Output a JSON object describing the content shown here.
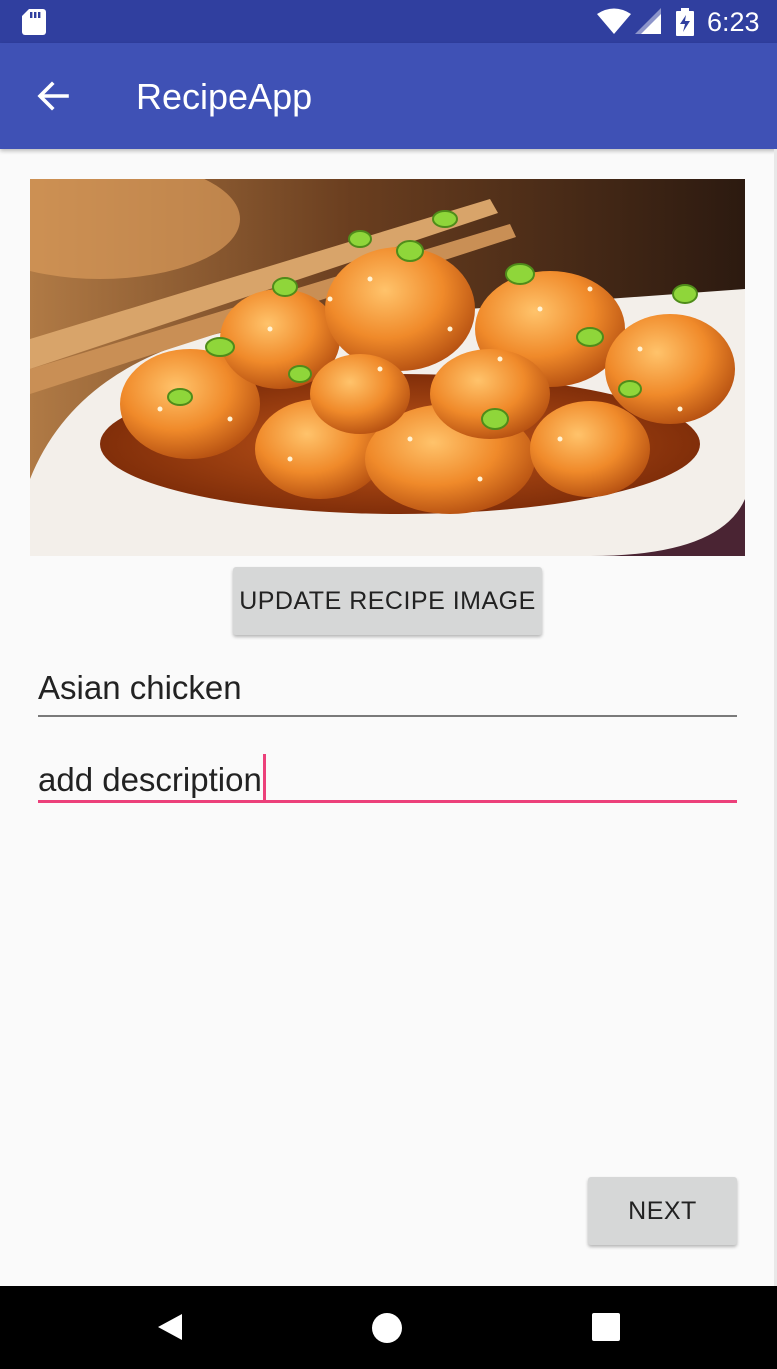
{
  "status_bar": {
    "time": "6:23",
    "icons": [
      "sd-card-icon",
      "wifi-icon",
      "cellular-signal-icon",
      "battery-charging-icon"
    ]
  },
  "app_bar": {
    "title": "RecipeApp",
    "back_icon": "arrow-back-icon",
    "color": "#3f51b5"
  },
  "recipe": {
    "image_icon": "recipe-photo-asian-chicken",
    "update_image_label": "UPDATE RECIPE IMAGE",
    "name_value": "Asian chicken",
    "description_value": "add description",
    "next_label": "NEXT",
    "accent_color": "#ec407a"
  },
  "nav_bar": {
    "icons": [
      "nav-back-icon",
      "nav-home-icon",
      "nav-recents-icon"
    ]
  }
}
